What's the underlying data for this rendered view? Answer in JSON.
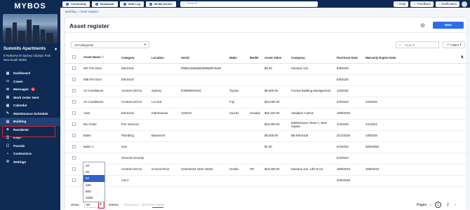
{
  "brand": {
    "logo": "MYBOS"
  },
  "site": {
    "name": "Summits Apartments",
    "address": "6 Parkview Dr Sydney Olympic Park New South Wales"
  },
  "sidebar": {
    "items": [
      {
        "label": "Dashboard",
        "icon": "grid-icon"
      },
      {
        "label": "Cases",
        "icon": "folder-icon"
      },
      {
        "label": "Messages",
        "icon": "envelope-icon",
        "badge": "2"
      },
      {
        "label": "Work Order Sent",
        "icon": "clipboard-icon"
      },
      {
        "label": "Calendar",
        "icon": "calendar-icon"
      },
      {
        "label": "Maintenance Schedule",
        "icon": "wrench-icon"
      },
      {
        "label": "Building",
        "icon": "building-icon"
      },
      {
        "label": "Residents",
        "icon": "people-icon"
      },
      {
        "label": "Keys",
        "icon": "key-icon"
      },
      {
        "label": "Parcels",
        "icon": "box-icon"
      },
      {
        "label": "Contractors",
        "icon": "hardhat-icon"
      },
      {
        "label": "Settings",
        "icon": "gear-icon"
      }
    ]
  },
  "topbar": {
    "buttons": [
      "Community",
      "Broadcast",
      "Shift Log",
      "Media Screen"
    ],
    "search_placeholder": "Search",
    "help": "Help",
    "feedback": "Feedback",
    "notification": "Notification"
  },
  "breadcrumb": {
    "root": "Building",
    "sep": ">",
    "current": "Asset register"
  },
  "page": {
    "title": "Asset register",
    "new_label": "New",
    "category_filter": "All Categories",
    "search_placeholder": "Search",
    "filters_label": "Filters"
  },
  "table": {
    "columns": [
      "Asset Name",
      "Category",
      "Location",
      "Serial",
      "Make",
      "Model",
      "Asset Value",
      "Company",
      "Purchase Date",
      "Warranty Expire Date"
    ],
    "rows": [
      [
        "087 Fire Door",
        "Electrical",
        "",
        "#6892c5a9a9d28955d07dc69",
        "",
        "",
        "$0.00",
        "Kamaon 241",
        "6/8/2025",
        ""
      ],
      [
        "088 Fire Door",
        "Electrical",
        "",
        "",
        "",
        "",
        "",
        "",
        "6/8/2025",
        ""
      ],
      [
        "Air Conditioner",
        "Central Air/Con",
        "Sydney",
        "878900970016",
        "Toyota",
        "",
        "$5,000.00",
        "Forrest Building Management",
        "1/2/2026",
        ""
      ],
      [
        "Air Conditioner",
        "Central Air/Con",
        "Lot 318",
        "",
        "Fuji",
        "",
        "$10,000.00",
        "",
        "2/2/2023",
        "2/2/2026"
      ],
      [
        "Asss",
        "Electrical",
        "Kathmandur",
        "1234XX",
        "Suzuki",
        "Honda2",
        "$32,323.00",
        "Abaddon Canton",
        "19/9/2025",
        ""
      ],
      [
        "Bin Chute",
        "Fire Services",
        "",
        "",
        "",
        "",
        "$10,000.00",
        "Maintenance Team 1, stew repairs",
        "1/4/2025",
        "1/1/2024"
      ],
      [
        "Boiler",
        "Plumbing",
        "Basement",
        "",
        "",
        "",
        "$5,000.00",
        "BB Electrical",
        "31/1/2025",
        "1/8/2025"
      ],
      [
        "Boiler 1",
        "Gas",
        "",
        "",
        "",
        "",
        "$1.00",
        "",
        "8/4/2024",
        "30/6/2050"
      ],
      [
        "",
        "General Security",
        "",
        "",
        "",
        "",
        "",
        "",
        "8/4/2024",
        ""
      ],
      [
        "",
        "Central Air/Con",
        "Ground Floor",
        "234234234 4234 43432",
        "Honda",
        "HP",
        "$10,000.00",
        "Kamaon 241, Lifts R Us",
        "18/9/2023",
        "19/9/2023"
      ],
      [
        "AME",
        "Cat 3",
        "",
        "",
        "",
        "",
        "",
        "",
        "20/5/2025",
        ""
      ]
    ]
  },
  "footer": {
    "show_label": "Show",
    "page_size": "50",
    "entries_label": "entries",
    "info": "Showing 1 - 50 of 68 entries",
    "pages_label": "Pages",
    "pages": [
      "1",
      "2"
    ],
    "current_page": "1"
  },
  "page_size_options": [
    "10",
    "20",
    "50",
    "100",
    "500",
    "1000"
  ],
  "colors": {
    "sidebar": "#0f2a52",
    "accent": "#2d6ee8",
    "highlight": "#d4202a"
  }
}
